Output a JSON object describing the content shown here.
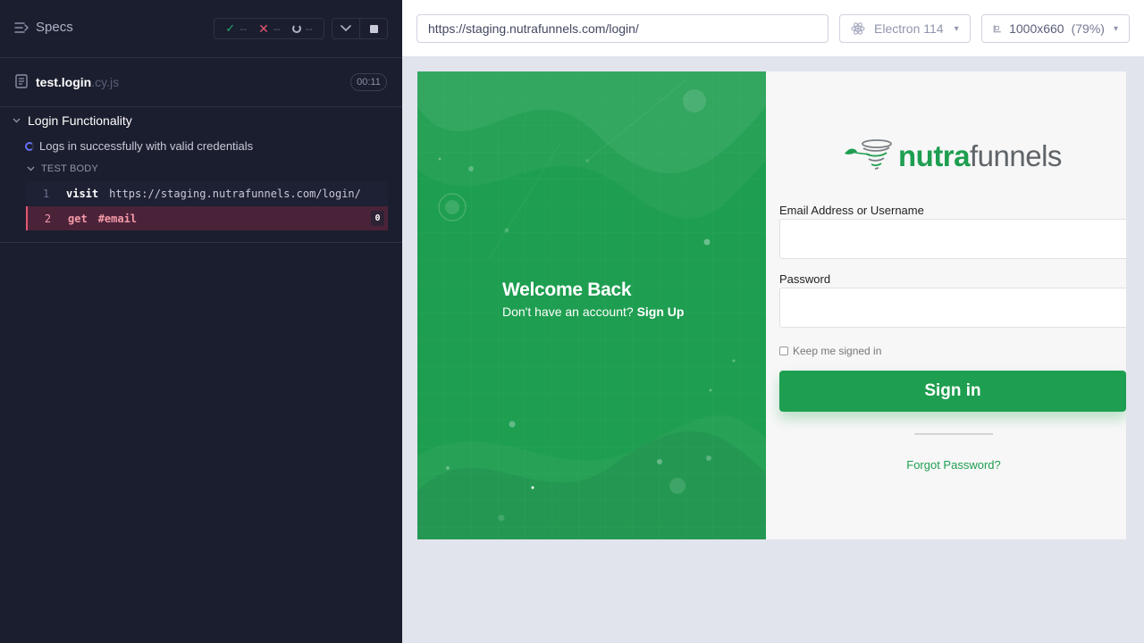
{
  "reporter": {
    "specs_label": "Specs",
    "stats": {
      "passed": "--",
      "failed": "--",
      "pending": "--"
    },
    "spec": {
      "name_base": "test.login",
      "name_ext": ".cy.js",
      "duration": "00:11"
    },
    "suite": {
      "title": "Login Functionality",
      "test_title": "Logs in successfully with valid credentials",
      "body_label": "TEST BODY",
      "commands": [
        {
          "num": "1",
          "name": "visit",
          "message": "https://staging.nutrafunnels.com/login/"
        },
        {
          "num": "2",
          "name": "get",
          "message": "#email",
          "badge": "0"
        }
      ]
    }
  },
  "aut_bar": {
    "url": "https://staging.nutrafunnels.com/login/",
    "browser": "Electron 114",
    "viewport": "1000x660",
    "zoom": "(79%)"
  },
  "login_page": {
    "welcome_title": "Welcome Back",
    "no_account_text": "Don't have an account?",
    "signup_link": "Sign Up",
    "logo_part1": "nutra",
    "logo_part2": "funnels",
    "email_label": "Email Address or Username",
    "password_label": "Password",
    "keep_signed_in": "Keep me signed in",
    "signin_label": "Sign in",
    "forgot_label": "Forgot Password?"
  },
  "colors": {
    "reporter_bg": "#1b1e2e",
    "brand_green": "#1e9e50",
    "failed_row": "#4b2339",
    "failed_text": "#f59aa9"
  }
}
